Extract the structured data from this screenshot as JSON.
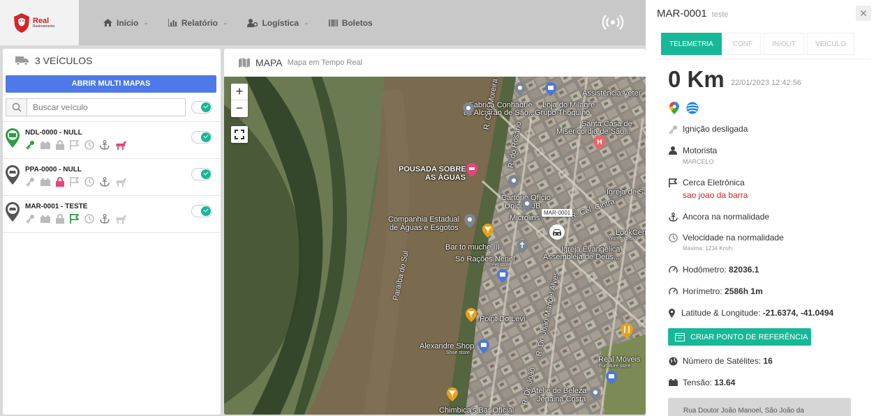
{
  "brand": {
    "name": "Real",
    "tagline": "Rastreamento"
  },
  "nav": {
    "items": [
      {
        "label": "Início",
        "dropdown": true
      },
      {
        "label": "Relatório",
        "dropdown": true
      },
      {
        "label": "Logística",
        "dropdown": true
      },
      {
        "label": "Boletos",
        "dropdown": false
      }
    ]
  },
  "vehicles_panel": {
    "count_label": "3 VEÍCULOS",
    "multi_map_button": "ABRIR MULTI MAPAS",
    "search_placeholder": "Buscar veículo",
    "vehicles": [
      {
        "name": "NDL-0000 - NULL",
        "pin_color": "#2e9e45",
        "enabled": true
      },
      {
        "name": "PPA-0000 - NULL",
        "pin_color": "#555555",
        "enabled": true
      },
      {
        "name": "MAR-0001 - TESTE",
        "pin_color": "#555555",
        "enabled": true
      }
    ]
  },
  "map_panel": {
    "title": "MAPA",
    "subtitle": "Mapa em Tempo Real",
    "zoom_in": "+",
    "zoom_out": "−",
    "labels": {
      "fabrica": "Fabrica Conhaque",
      "alcatrao": "de Alcatrão de São...",
      "loja": "Loja do Milagre",
      "grupo": "Grupo Thoquino",
      "assistencia": "Assistência Veter",
      "santa_casa1": "Santa Casa de",
      "santa_casa2": "Misericórdia de São...",
      "rcel": "R. Cel. Moreira",
      "rrosario": "R. do Rosário",
      "pousada1": "POUSADA SOBRE",
      "pousada2": "AS ÁGUAS",
      "cartorio1": "Cartório Ofício",
      "cartorio2": "Único SJB",
      "rcelcintra": "R. Cel. Cintra",
      "igreja_sa": "Igreja de Sa",
      "microlins": "Microlins",
      "companhia1": "Companhia Estadual",
      "companhia2": "de Águas e Esgotos",
      "lookcenter": "LookCen",
      "womens": "Women's clo",
      "bar": "Bar to muche III",
      "igreja_ev1": "Igreja Evangélica",
      "igreja_ev2": "Assembléia de Deus...",
      "so_racoes": "Só Rações Nenel",
      "petstore": "Pet store",
      "paraiba": "Paraíba do Sul",
      "point": "Point Do Levi",
      "rjoao": "R. Dr. João Manoel Alves",
      "alexandre": "Alexandre Shop",
      "shoestore": "Shoe store",
      "real_moveis": "Real Móveis",
      "furniture": "Furniture store",
      "atelie1": "Atelie de Beleza",
      "atelie2": "Jenaina Costa",
      "chimbica": "Chimbica's Bar Oficial",
      "rdr": "R. Dr. João"
    },
    "vehicle_label": "MAR-0001"
  },
  "detail": {
    "title": "MAR-0001",
    "subtitle": "teste",
    "close": "✕",
    "tabs": [
      {
        "label": "TELEMETRIA",
        "active": true
      },
      {
        "label": "CONF",
        "active": false
      },
      {
        "label": "IN/OUT",
        "active": false
      },
      {
        "label": "VEÍCULO",
        "active": false
      }
    ],
    "km": "0 Km",
    "datetime": "22/01/2023 12:42:56",
    "ignition": "Ignição desligada",
    "driver_label": "Motorista",
    "driver_name": "MARCELO",
    "fence_label": "Cerca Eletrônica",
    "fence_value": "sao joao da barra",
    "anchor": "Ancora na normalidade",
    "speed_label": "Velocidade na normalidade",
    "speed_max": "Máxima: 1234 Km/h",
    "odometer_label": "Hodômetro:",
    "odometer_value": "82036.1",
    "hourmeter_label": "Horímetro:",
    "hourmeter_value": "2586h 1m",
    "latlng_label": "Latitude & Longitude:",
    "latlng_value": "-21.6374, -41.0494",
    "ref_button": "CRIAR PONTO DE REFERÊNCIA",
    "satellites_label": "Número de Satélites:",
    "satellites_value": "16",
    "voltage_label": "Tensão:",
    "voltage_value": "13.64",
    "address": "Rua Doutor João Manoel, São João da"
  },
  "colors": {
    "accent_green": "#17b897",
    "accent_blue": "#4f79e8",
    "alert_red": "#e02020",
    "pink": "#e8457a"
  }
}
